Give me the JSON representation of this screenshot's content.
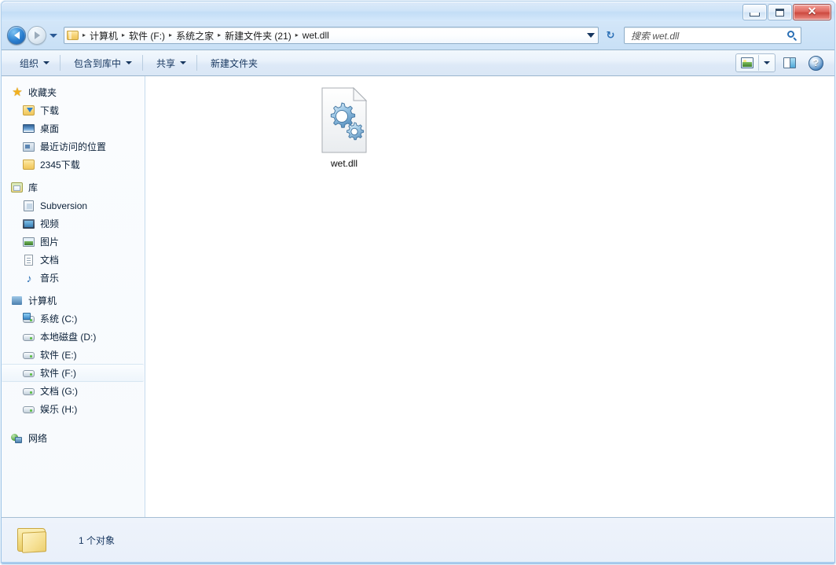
{
  "window": {
    "controls": {
      "minimize_label": "—",
      "maximize_label": "□",
      "close_label": "✕"
    }
  },
  "address_bar": {
    "back_tooltip": "后退",
    "forward_tooltip": "前进",
    "breadcrumbs": [
      {
        "label": "计算机"
      },
      {
        "label": "软件 (F:)"
      },
      {
        "label": "系统之家"
      },
      {
        "label": "新建文件夹 (21)"
      },
      {
        "label": "wet.dll"
      }
    ],
    "separator": "▸",
    "refresh_label": "↻"
  },
  "search": {
    "placeholder": "搜索 wet.dll",
    "value": ""
  },
  "toolbar": {
    "items": [
      {
        "label": "组织",
        "has_caret": true
      },
      {
        "label": "包含到库中",
        "has_caret": true
      },
      {
        "label": "共享",
        "has_caret": true
      },
      {
        "label": "新建文件夹",
        "has_caret": false
      }
    ],
    "view_button": "view-mode",
    "preview_button": "preview-pane",
    "help_label": "?"
  },
  "sidebar": {
    "groups": [
      {
        "header": {
          "label": "收藏夹",
          "icon": "star-icon"
        },
        "items": [
          {
            "label": "下载",
            "icon": "downloads-folder-icon",
            "selected": false
          },
          {
            "label": "桌面",
            "icon": "desktop-icon",
            "selected": false
          },
          {
            "label": "最近访问的位置",
            "icon": "recent-places-icon",
            "selected": false
          },
          {
            "label": "2345下载",
            "icon": "folder-icon",
            "selected": false
          }
        ]
      },
      {
        "header": {
          "label": "库",
          "icon": "library-icon"
        },
        "items": [
          {
            "label": "Subversion",
            "icon": "subversion-icon",
            "selected": false
          },
          {
            "label": "视频",
            "icon": "video-icon",
            "selected": false
          },
          {
            "label": "图片",
            "icon": "pictures-icon",
            "selected": false
          },
          {
            "label": "文档",
            "icon": "documents-icon",
            "selected": false
          },
          {
            "label": "音乐",
            "icon": "music-icon",
            "selected": false
          }
        ]
      },
      {
        "header": {
          "label": "计算机",
          "icon": "computer-icon"
        },
        "items": [
          {
            "label": "系统 (C:)",
            "icon": "system-drive-icon",
            "selected": false
          },
          {
            "label": "本地磁盘 (D:)",
            "icon": "drive-icon",
            "selected": false
          },
          {
            "label": "软件 (E:)",
            "icon": "drive-icon",
            "selected": false
          },
          {
            "label": "软件 (F:)",
            "icon": "drive-icon",
            "selected": true
          },
          {
            "label": "文档 (G:)",
            "icon": "drive-icon",
            "selected": false
          },
          {
            "label": "娱乐 (H:)",
            "icon": "drive-icon",
            "selected": false
          }
        ]
      },
      {
        "header": {
          "label": "网络",
          "icon": "network-icon"
        },
        "items": []
      }
    ]
  },
  "content": {
    "files": [
      {
        "name": "wet.dll",
        "icon": "dll-gears-icon"
      }
    ]
  },
  "status_bar": {
    "item_count_text": "1 个对象",
    "icon": "folder-icon"
  },
  "colors": {
    "accent": "#2a6fb5",
    "titlebar": "#cfe4f8",
    "toolbar": "#eaf2fb",
    "close_button": "#cc4a40",
    "selection": "#eef5fb",
    "content_bg": "#ffffff"
  }
}
